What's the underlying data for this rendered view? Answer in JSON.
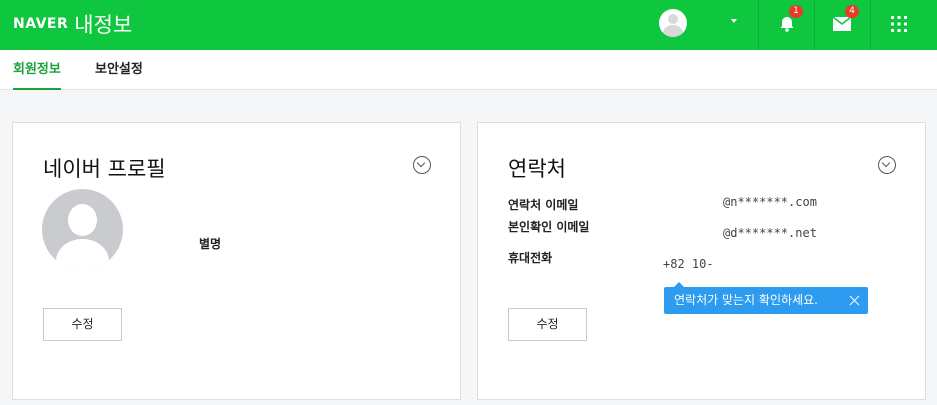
{
  "header": {
    "logo": "NAVER",
    "title": "내정보",
    "notification_count": "1",
    "mail_count": "4",
    "icons": [
      "profile-avatar",
      "caret-down",
      "bell-icon",
      "mail-icon",
      "apps-grid-icon"
    ]
  },
  "tabs": [
    {
      "label": "회원정보",
      "active": true
    },
    {
      "label": "보안설정",
      "active": false
    }
  ],
  "profile_card": {
    "title": "네이버 프로필",
    "nickname_label": "별명",
    "edit_label": "수정"
  },
  "contact_card": {
    "title": "연락처",
    "rows": [
      {
        "label": "연락처 이메일",
        "value": "@n*******.com"
      },
      {
        "label": "본인확인 이메일",
        "value": "@d*******.net"
      },
      {
        "label": "휴대전화",
        "value": "+82 10-"
      }
    ],
    "tooltip": "연락처가 맞는지 확인하세요.",
    "edit_label": "수정"
  },
  "colors": {
    "brand_green": "#0fc63f",
    "tab_active": "#1aa23b",
    "tooltip_blue": "#2d9bf0",
    "badge_red": "#e8392b"
  }
}
